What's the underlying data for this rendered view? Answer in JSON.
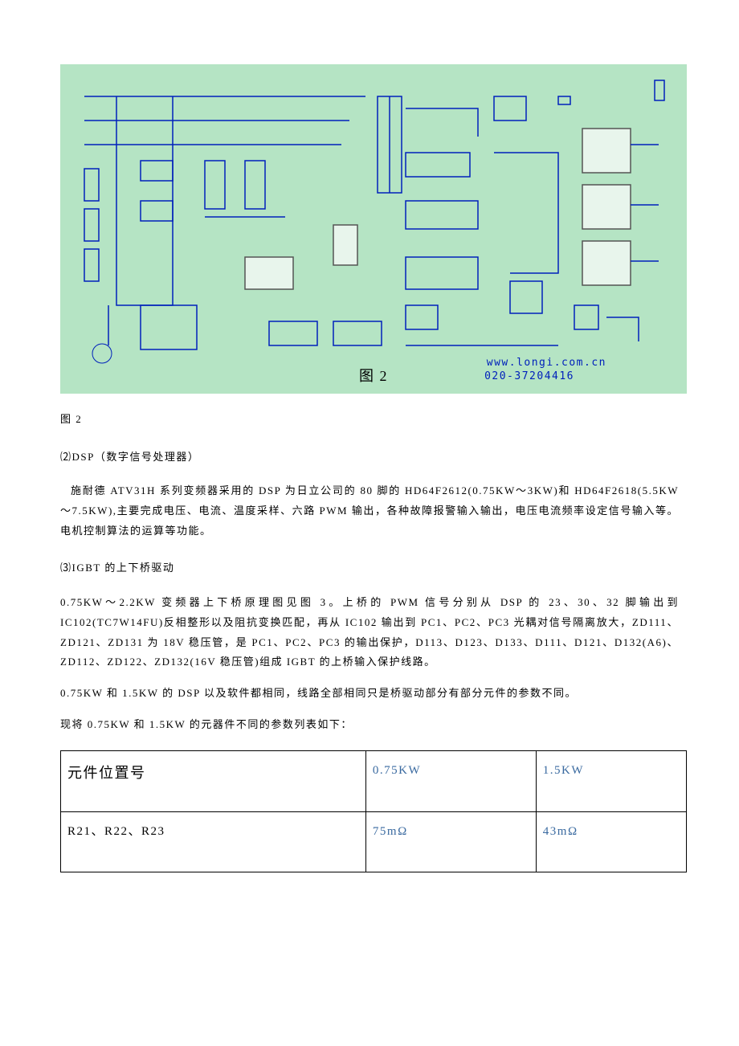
{
  "figure": {
    "inline_caption": "图 2",
    "url": "www.longi.com.cn",
    "phone": "020-37204416"
  },
  "caption": "图 2",
  "sections": {
    "dsp": {
      "header": "⑵DSP（数字信号处理器）",
      "para": "施耐德 ATV31H 系列变频器采用的 DSP 为日立公司的 80 脚的 HD64F2612(0.75KW～3KW)和 HD64F2618(5.5KW～7.5KW),主要完成电压、电流、温度采样、六路 PWM 输出，各种故障报警输入输出，电压电流频率设定信号输入等。电机控制算法的运算等功能。"
    },
    "igbt": {
      "header": "⑶IGBT 的上下桥驱动",
      "para1": "0.75KW～2.2KW 变频器上下桥原理图见图 3。上桥的 PWM 信号分别从 DSP 的 23、30、32 脚输出到 IC102(TC7W14FU)反相整形以及阻抗变换匹配，再从 IC102 输出到 PC1、PC2、PC3 光耦对信号隔离放大，ZD111、ZD121、ZD131 为 18V 稳压管，是 PC1、PC2、PC3 的输出保护，D113、D123、D133、D111、D121、D132(A6)、ZD112、ZD122、ZD132(16V 稳压管)组成 IGBT 的上桥输入保护线路。",
      "para2": "0.75KW 和 1.5KW 的 DSP 以及软件都相同，线路全部相同只是桥驱动部分有部分元件的参数不同。",
      "para3": "现将 0.75KW 和 1.5KW 的元器件不同的参数列表如下："
    }
  },
  "table": {
    "headers": [
      "元件位置号",
      "0.75KW",
      "1.5KW"
    ],
    "rows": [
      [
        "R21、R22、R23",
        "75mΩ",
        "43mΩ"
      ]
    ]
  }
}
